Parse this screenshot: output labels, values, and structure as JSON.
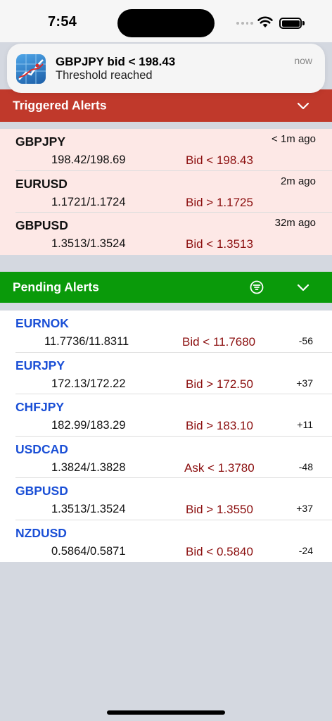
{
  "status_bar": {
    "time": "7:54"
  },
  "notification": {
    "icon": "chart-app-icon",
    "title": "GBPJPY bid < 198.43",
    "body": "Threshold reached",
    "time": "now"
  },
  "triggered": {
    "title": "Triggered Alerts",
    "color": "#c0392b",
    "items": [
      {
        "symbol": "GBPJPY",
        "quote": "198.42/198.69",
        "condition": "Bid < 198.43",
        "ago": "< 1m ago"
      },
      {
        "symbol": "EURUSD",
        "quote": "1.1721/1.1724",
        "condition": "Bid > 1.1725",
        "ago": "2m ago"
      },
      {
        "symbol": "GBPUSD",
        "quote": "1.3513/1.3524",
        "condition": "Bid < 1.3513",
        "ago": "32m ago"
      }
    ]
  },
  "pending": {
    "title": "Pending Alerts",
    "color": "#0a9a0a",
    "items": [
      {
        "symbol": "EURNOK",
        "quote": "11.7736/11.8311",
        "condition": "Bid < 11.7680",
        "diff": "-56"
      },
      {
        "symbol": "EURJPY",
        "quote": "172.13/172.22",
        "condition": "Bid > 172.50",
        "diff": "+37"
      },
      {
        "symbol": "CHFJPY",
        "quote": "182.99/183.29",
        "condition": "Bid > 183.10",
        "diff": "+11"
      },
      {
        "symbol": "USDCAD",
        "quote": "1.3824/1.3828",
        "condition": "Ask < 1.3780",
        "diff": "-48"
      },
      {
        "symbol": "GBPUSD",
        "quote": "1.3513/1.3524",
        "condition": "Bid > 1.3550",
        "diff": "+37"
      },
      {
        "symbol": "NZDUSD",
        "quote": "0.5864/0.5871",
        "condition": "Bid < 0.5840",
        "diff": "-24"
      }
    ]
  }
}
